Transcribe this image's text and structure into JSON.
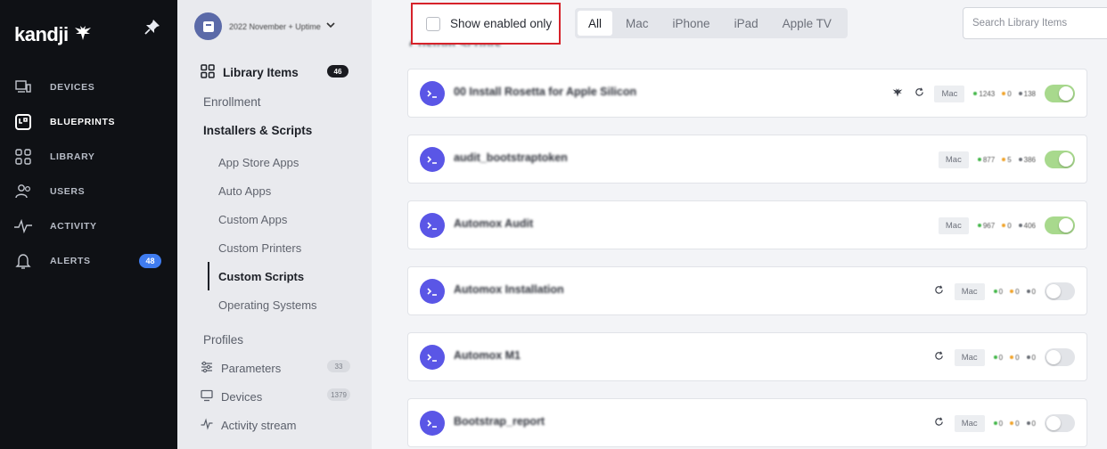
{
  "brand": {
    "name": "kandji"
  },
  "nav": [
    {
      "label": "DEVICES",
      "icon": "devices-icon",
      "active": false
    },
    {
      "label": "BLUEPRINTS",
      "icon": "blueprints-icon",
      "active": true
    },
    {
      "label": "LIBRARY",
      "icon": "library-icon",
      "active": false
    },
    {
      "label": "USERS",
      "icon": "users-icon",
      "active": false
    },
    {
      "label": "ACTIVITY",
      "icon": "activity-icon",
      "active": false
    },
    {
      "label": "ALERTS",
      "icon": "bell-icon",
      "active": false,
      "badge": "48"
    }
  ],
  "blueprint": {
    "name": "2022 November + Uptime"
  },
  "sidebar": {
    "library_items": {
      "label": "Library Items",
      "badge": "46"
    },
    "enrollment": "Enrollment",
    "installers": "Installers & Scripts",
    "sub_items": [
      "App Store Apps",
      "Auto Apps",
      "Custom Apps",
      "Custom Printers",
      "Custom Scripts",
      "Operating Systems"
    ],
    "active_sub": "Custom Scripts",
    "profiles": "Profiles",
    "parameters": {
      "label": "Parameters",
      "count": "33"
    },
    "devices": {
      "label": "Devices",
      "count": "1379"
    },
    "activity_stream": {
      "label": "Activity stream"
    }
  },
  "toolbar": {
    "show_enabled_label": "Show enabled only",
    "filters": [
      "All",
      "Mac",
      "iPhone",
      "iPad",
      "Apple TV"
    ],
    "selected_filter": "All",
    "search_placeholder": "Search Library Items"
  },
  "section_title": "Custom Scripts",
  "colors": {
    "accent": "#5a56e6",
    "toggle_on": "#a8d98d",
    "nav_bg": "#0f1115",
    "highlight_border": "#d6222a"
  },
  "items": [
    {
      "name": "00 Install Rosetta for Apple Silicon",
      "platform": "Mac",
      "kandji_icon": true,
      "refresh_icon": true,
      "stats": [
        "1243",
        "0",
        "138"
      ],
      "enabled": true
    },
    {
      "name": "audit_bootstraptoken",
      "platform": "Mac",
      "kandji_icon": false,
      "refresh_icon": false,
      "stats": [
        "877",
        "5",
        "386"
      ],
      "enabled": true
    },
    {
      "name": "Automox Audit",
      "platform": "Mac",
      "kandji_icon": false,
      "refresh_icon": false,
      "stats": [
        "967",
        "0",
        "406"
      ],
      "enabled": true
    },
    {
      "name": "Automox Installation",
      "platform": "Mac",
      "kandji_icon": false,
      "refresh_icon": true,
      "stats": [
        "0",
        "0",
        "0"
      ],
      "enabled": false
    },
    {
      "name": "Automox M1",
      "platform": "Mac",
      "kandji_icon": false,
      "refresh_icon": true,
      "stats": [
        "0",
        "0",
        "0"
      ],
      "enabled": false
    },
    {
      "name": "Bootstrap_report",
      "platform": "Mac",
      "kandji_icon": false,
      "refresh_icon": true,
      "stats": [
        "0",
        "0",
        "0"
      ],
      "enabled": false
    }
  ]
}
